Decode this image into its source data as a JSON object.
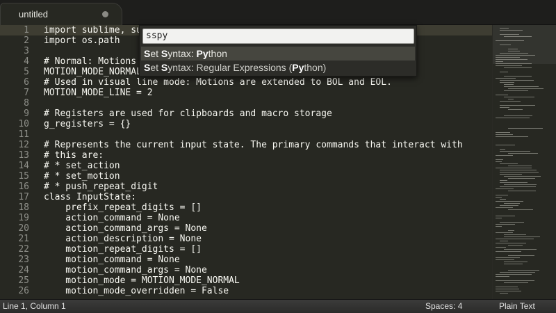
{
  "tab": {
    "title": "untitled"
  },
  "editor": {
    "line_numbers": [
      "1",
      "2",
      "3",
      "4",
      "5",
      "6",
      "7",
      "8",
      "9",
      "10",
      "11",
      "12",
      "13",
      "14",
      "15",
      "16",
      "17",
      "18",
      "19",
      "20",
      "21",
      "22",
      "23",
      "24",
      "25",
      "26"
    ],
    "lines": [
      "import sublime, sublime_plugin",
      "import os.path",
      "",
      "# Normal: Motions apply to all the characters they select",
      "MOTION_MODE_NORMAL = 0",
      "# Used in visual line mode: Motions are extended to BOL and EOL.",
      "MOTION_MODE_LINE = 2",
      "",
      "# Registers are used for clipboards and macro storage",
      "g_registers = {}",
      "",
      "# Represents the current input state. The primary commands that interact with",
      "# this are:",
      "# * set_action",
      "# * set_motion",
      "# * push_repeat_digit",
      "class InputState:",
      "    prefix_repeat_digits = []",
      "    action_command = None",
      "    action_command_args = None",
      "    action_description = None",
      "    motion_repeat_digits = []",
      "    motion_command = None",
      "    motion_command_args = None",
      "    motion_mode = MOTION_MODE_NORMAL",
      "    motion_mode_overridden = False"
    ]
  },
  "palette": {
    "query": "sspy",
    "results": [
      {
        "label": "Set Syntax: Python",
        "selected": true
      },
      {
        "label": "Set Syntax: Regular Expressions (Python)",
        "selected": false
      }
    ]
  },
  "statusbar": {
    "position": "Line 1, Column 1",
    "indentation": "Spaces: 4",
    "syntax": "Plain Text"
  }
}
